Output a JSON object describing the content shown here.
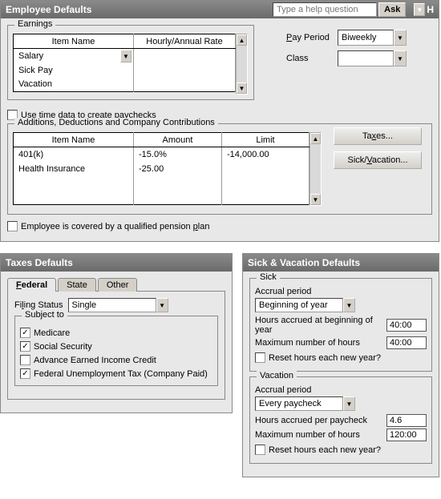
{
  "main": {
    "title": "Employee Defaults",
    "help_placeholder": "Type a help question",
    "ask_label": "Ask",
    "top_right_label": "H",
    "earnings": {
      "legend": "Earnings",
      "cols": [
        "Item Name",
        "Hourly/Annual Rate"
      ],
      "rows": [
        {
          "name": "Salary",
          "rate": ""
        },
        {
          "name": "Sick Pay",
          "rate": ""
        },
        {
          "name": "Vacation",
          "rate": ""
        }
      ]
    },
    "pay_period": {
      "label": "Pay Period",
      "value": "Biweekly"
    },
    "class": {
      "label": "Class",
      "value": ""
    },
    "use_time_data": {
      "label_pre": "Use time data to create ",
      "u": "p",
      "label_post": "aychecks",
      "checked": false
    },
    "addc": {
      "legend": "Additions, Deductions and Company Contributions",
      "cols": [
        "Item Name",
        "Amount",
        "Limit"
      ],
      "rows": [
        {
          "name": "401(k)",
          "amount": "-15.0%",
          "limit": "-14,000.00"
        },
        {
          "name": "Health Insurance",
          "amount": "-25.00",
          "limit": ""
        }
      ],
      "taxes_btn": "Taxes...",
      "sv_btn": "Sick/Vacation...",
      "taxes_u": "x",
      "sv_u": "V"
    },
    "pension": {
      "label_pre": "Employee is covered by a qualified pension ",
      "u": "p",
      "label_post": "lan",
      "checked": false
    }
  },
  "taxes": {
    "title": "Taxes Defaults",
    "tabs": {
      "federal": "Federal",
      "state": "State",
      "other": "Other"
    },
    "filing": {
      "label": "Filing Status",
      "value": "Single"
    },
    "subject": {
      "label": "Subject to",
      "items": [
        {
          "label": "Medicare",
          "checked": true
        },
        {
          "label": "Social Security",
          "checked": true
        },
        {
          "label": "Advance Earned Income Credit",
          "checked": false
        },
        {
          "label": "Federal Unemployment Tax (Company Paid)",
          "checked": true
        }
      ]
    }
  },
  "sv": {
    "title": "Sick & Vacation Defaults",
    "sections": {
      "sick": {
        "legend": "Sick",
        "accrual_label": "Accrual period",
        "accrual_value": "Beginning of year",
        "hours_begin_label": "Hours accrued at beginning of year",
        "hours_begin_value": "40:00",
        "max_label": "Maximum number of hours",
        "max_value": "40:00",
        "reset_label": "Reset hours each new year?",
        "reset_checked": false
      },
      "vacation": {
        "legend": "Vacation",
        "accrual_label": "Accrual period",
        "accrual_value": "Every paycheck",
        "hours_pp_label": "Hours accrued per paycheck",
        "hours_pp_value": "4.6",
        "max_label": "Maximum number of hours",
        "max_value": "120:00",
        "reset_label": "Reset hours each new year?",
        "reset_checked": false
      }
    }
  }
}
